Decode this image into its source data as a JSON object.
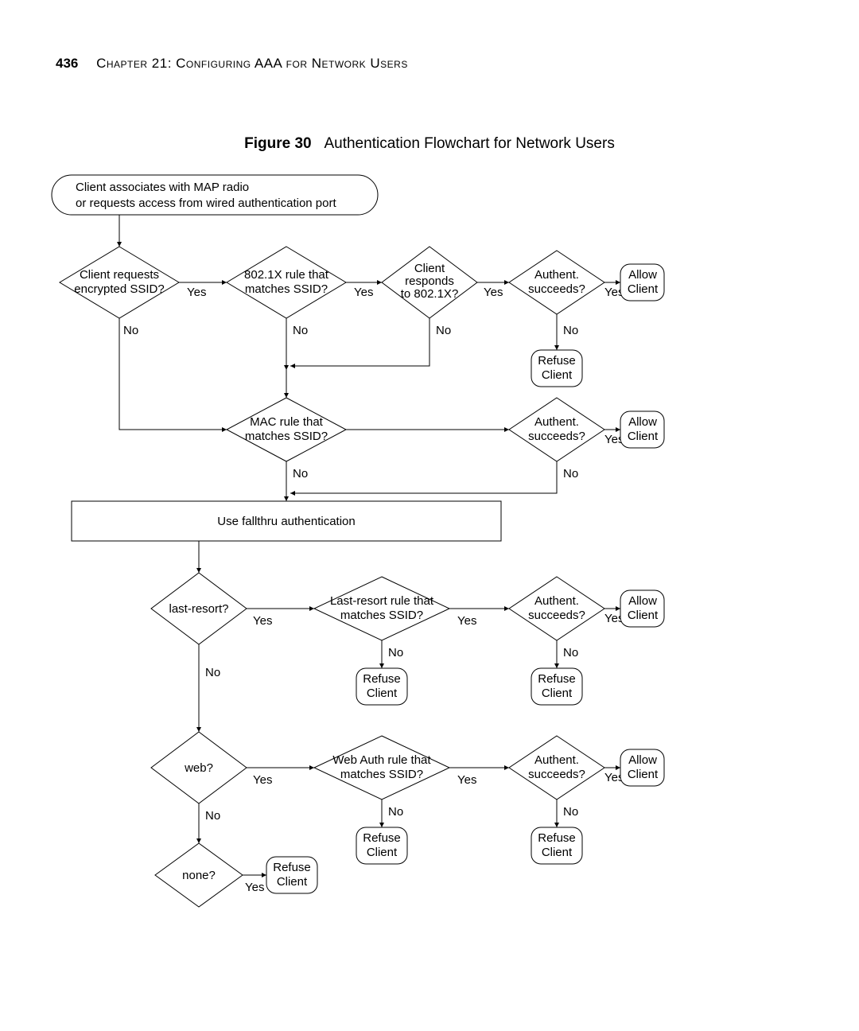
{
  "header": {
    "page": "436",
    "chapter": "Chapter 21: Configuring AAA for Network Users"
  },
  "caption": {
    "label": "Figure 30",
    "title": "Authentication Flowchart for Network Users"
  },
  "labels": {
    "yes": "Yes",
    "no": "No"
  },
  "nodes": {
    "start": {
      "l1": "Client associates with MAP radio",
      "l2": "or requests access from wired authentication port"
    },
    "d1": {
      "l1": "Client requests",
      "l2": "encrypted SSID?"
    },
    "d2": {
      "l1": "802.1X rule that",
      "l2": "matches SSID?"
    },
    "d3": {
      "l1": "Client",
      "l2": "responds",
      "l3": "to 802.1X?"
    },
    "auth": {
      "l1": "Authent.",
      "l2": "succeeds?"
    },
    "allow": {
      "l1": "Allow",
      "l2": "Client"
    },
    "refuse": {
      "l1": "Refuse",
      "l2": "Client"
    },
    "d5": {
      "l1": "MAC rule that",
      "l2": "matches SSID?"
    },
    "fallthru": "Use fallthru authentication",
    "d7": "last-resort?",
    "d8": {
      "l1": "Last-resort rule that",
      "l2": "matches SSID?"
    },
    "d10": "web?",
    "d11": {
      "l1": "Web Auth rule that",
      "l2": "matches SSID?"
    },
    "d13": "none?"
  },
  "chart_data": {
    "type": "flowchart",
    "nodes": [
      {
        "id": "start",
        "shape": "terminator",
        "text": "Client associates with MAP radio or requests access from wired authentication port"
      },
      {
        "id": "d1",
        "shape": "decision",
        "text": "Client requests encrypted SSID?"
      },
      {
        "id": "d2",
        "shape": "decision",
        "text": "802.1X rule that matches SSID?"
      },
      {
        "id": "d3",
        "shape": "decision",
        "text": "Client responds to 802.1X?"
      },
      {
        "id": "d4",
        "shape": "decision",
        "text": "Authent. succeeds?"
      },
      {
        "id": "allow1",
        "shape": "terminator",
        "text": "Allow Client"
      },
      {
        "id": "refuse1",
        "shape": "terminator",
        "text": "Refuse Client"
      },
      {
        "id": "d5",
        "shape": "decision",
        "text": "MAC rule that matches SSID?"
      },
      {
        "id": "d6",
        "shape": "decision",
        "text": "Authent. succeeds?"
      },
      {
        "id": "allow2",
        "shape": "terminator",
        "text": "Allow Client"
      },
      {
        "id": "fallthru",
        "shape": "process",
        "text": "Use fallthru authentication"
      },
      {
        "id": "d7",
        "shape": "decision",
        "text": "last-resort?"
      },
      {
        "id": "d8",
        "shape": "decision",
        "text": "Last-resort rule that matches SSID?"
      },
      {
        "id": "d9",
        "shape": "decision",
        "text": "Authent. succeeds?"
      },
      {
        "id": "allow3",
        "shape": "terminator",
        "text": "Allow Client"
      },
      {
        "id": "refuse8",
        "shape": "terminator",
        "text": "Refuse Client"
      },
      {
        "id": "refuse9",
        "shape": "terminator",
        "text": "Refuse Client"
      },
      {
        "id": "d10",
        "shape": "decision",
        "text": "web?"
      },
      {
        "id": "d11",
        "shape": "decision",
        "text": "Web Auth rule that matches SSID?"
      },
      {
        "id": "d12",
        "shape": "decision",
        "text": "Authent. succeeds?"
      },
      {
        "id": "allow4",
        "shape": "terminator",
        "text": "Allow Client"
      },
      {
        "id": "refuse11",
        "shape": "terminator",
        "text": "Refuse Client"
      },
      {
        "id": "refuse12",
        "shape": "terminator",
        "text": "Refuse Client"
      },
      {
        "id": "d13",
        "shape": "decision",
        "text": "none?"
      },
      {
        "id": "refuse13",
        "shape": "terminator",
        "text": "Refuse Client"
      }
    ],
    "edges": [
      {
        "from": "start",
        "to": "d1"
      },
      {
        "from": "d1",
        "to": "d2",
        "label": "Yes"
      },
      {
        "from": "d1",
        "to": "d5",
        "label": "No"
      },
      {
        "from": "d2",
        "to": "d3",
        "label": "Yes"
      },
      {
        "from": "d2",
        "to": "d5",
        "label": "No"
      },
      {
        "from": "d3",
        "to": "d4",
        "label": "Yes"
      },
      {
        "from": "d3",
        "to": "d5",
        "label": "No"
      },
      {
        "from": "d4",
        "to": "allow1",
        "label": "Yes"
      },
      {
        "from": "d4",
        "to": "refuse1",
        "label": "No"
      },
      {
        "from": "d5",
        "to": "d6",
        "label": "Yes"
      },
      {
        "from": "d5",
        "to": "fallthru",
        "label": "No"
      },
      {
        "from": "d6",
        "to": "allow2",
        "label": "Yes"
      },
      {
        "from": "d6",
        "to": "fallthru",
        "label": "No"
      },
      {
        "from": "fallthru",
        "to": "d7"
      },
      {
        "from": "d7",
        "to": "d8",
        "label": "Yes"
      },
      {
        "from": "d7",
        "to": "d10",
        "label": "No"
      },
      {
        "from": "d8",
        "to": "d9",
        "label": "Yes"
      },
      {
        "from": "d8",
        "to": "refuse8",
        "label": "No"
      },
      {
        "from": "d9",
        "to": "allow3",
        "label": "Yes"
      },
      {
        "from": "d9",
        "to": "refuse9",
        "label": "No"
      },
      {
        "from": "d10",
        "to": "d11",
        "label": "Yes"
      },
      {
        "from": "d10",
        "to": "d13",
        "label": "No"
      },
      {
        "from": "d11",
        "to": "d12",
        "label": "Yes"
      },
      {
        "from": "d11",
        "to": "refuse11",
        "label": "No"
      },
      {
        "from": "d12",
        "to": "allow4",
        "label": "Yes"
      },
      {
        "from": "d12",
        "to": "refuse12",
        "label": "No"
      },
      {
        "from": "d13",
        "to": "refuse13",
        "label": "Yes"
      }
    ]
  }
}
